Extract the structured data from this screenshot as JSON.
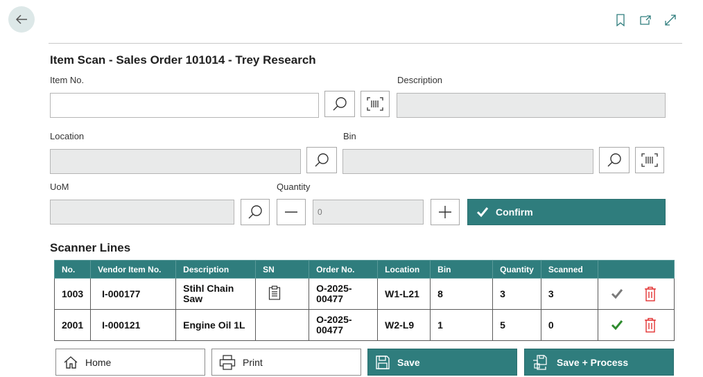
{
  "header": {
    "back_icon": "arrow-left-icon",
    "icons": [
      "bookmark-icon",
      "open-new-window-icon",
      "expand-icon"
    ]
  },
  "form": {
    "title": "Item Scan - Sales Order 101014 - Trey Research",
    "item_no": {
      "label": "Item No.",
      "value": ""
    },
    "description": {
      "label": "Description",
      "value": ""
    },
    "location": {
      "label": "Location",
      "value": ""
    },
    "bin": {
      "label": "Bin",
      "value": ""
    },
    "uom": {
      "label": "UoM",
      "value": ""
    },
    "quantity": {
      "label": "Quantity",
      "value": "0"
    },
    "confirm_label": "Confirm"
  },
  "scanner_lines": {
    "title": "Scanner Lines",
    "columns": [
      "No.",
      "Vendor Item No.",
      "Description",
      "SN",
      "Order No.",
      "Location",
      "Bin",
      "Quantity",
      "Scanned",
      ""
    ],
    "rows": [
      {
        "no": "1003",
        "vendor_item_no": "I-000177",
        "description": "Stihl Chain Saw",
        "sn_icon": "clipboard-icon",
        "order_no": "O-2025-00477",
        "location": "W1-L21",
        "bin": "8",
        "quantity": "3",
        "scanned": "3",
        "check_color": "#7a7a7a"
      },
      {
        "no": "2001",
        "vendor_item_no": "I-000121",
        "description": "Engine Oil 1L",
        "sn_icon": "",
        "order_no": "O-2025-00477",
        "location": "W2-L9",
        "bin": "1",
        "quantity": "5",
        "scanned": "0",
        "check_color": "#2e8b2e"
      }
    ]
  },
  "footer": {
    "home_label": "Home",
    "print_label": "Print",
    "save_label": "Save",
    "save_process_label": "Save + Process"
  },
  "colors": {
    "accent": "#2f7d7d",
    "delete": "#e02424"
  }
}
